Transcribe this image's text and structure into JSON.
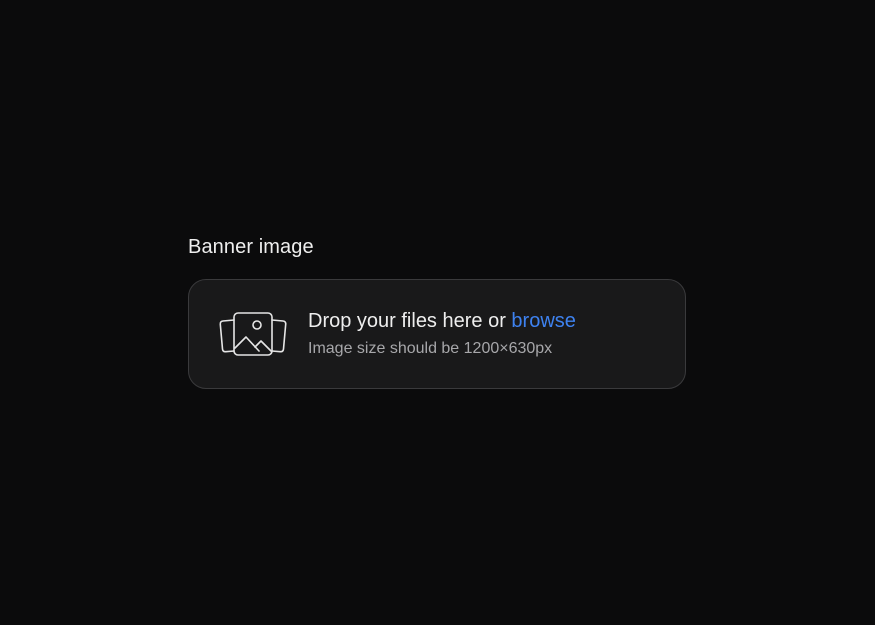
{
  "upload": {
    "label": "Banner image",
    "title_prefix": "Drop your files here or ",
    "browse_label": "browse",
    "hint": "Image size should be 1200×630px",
    "icon": "images-stack-icon"
  },
  "colors": {
    "background": "#0b0b0c",
    "dropzone_background": "#19191a",
    "dropzone_border": "#3a3a3c",
    "text_primary": "#eeeeee",
    "text_secondary": "#a7a7aa",
    "link": "#3e82f0"
  }
}
